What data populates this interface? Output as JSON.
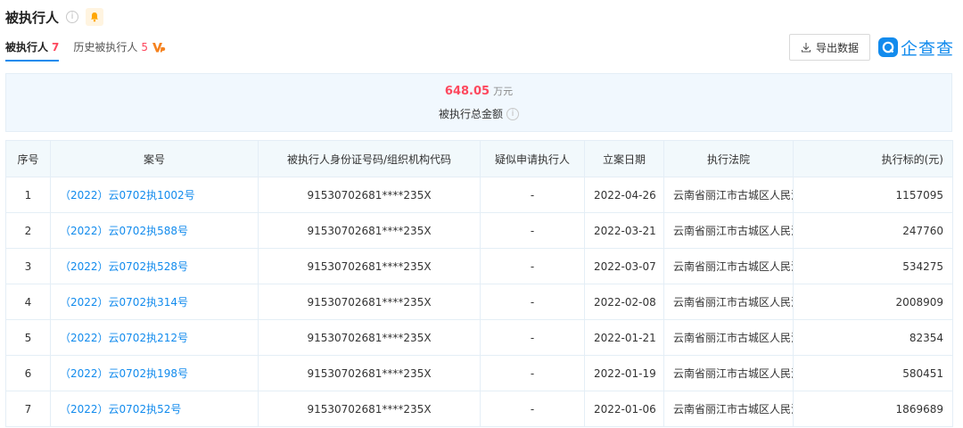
{
  "header": {
    "title": "被执行人",
    "info_glyph": "i"
  },
  "tabs": [
    {
      "label": "被执行人",
      "count": "7",
      "active": true
    },
    {
      "label": "历史被执行人",
      "count": "5",
      "active": false
    }
  ],
  "toolbar": {
    "export_label": "导出数据",
    "brand": "企查查"
  },
  "summary": {
    "amount": "648.05",
    "unit": "万元",
    "label": "被执行总金额"
  },
  "table": {
    "columns": [
      "序号",
      "案号",
      "被执行人身份证号码/组织机构代码",
      "疑似申请执行人",
      "立案日期",
      "执行法院",
      "执行标的(元)"
    ],
    "rows": [
      {
        "no": "1",
        "case": "（2022）云0702执1002号",
        "id": "91530702681****235X",
        "applicant": "-",
        "date": "2022-04-26",
        "court": "云南省丽江市古城区人民法院",
        "amount": "1157095"
      },
      {
        "no": "2",
        "case": "（2022）云0702执588号",
        "id": "91530702681****235X",
        "applicant": "-",
        "date": "2022-03-21",
        "court": "云南省丽江市古城区人民法院",
        "amount": "247760"
      },
      {
        "no": "3",
        "case": "（2022）云0702执528号",
        "id": "91530702681****235X",
        "applicant": "-",
        "date": "2022-03-07",
        "court": "云南省丽江市古城区人民法院",
        "amount": "534275"
      },
      {
        "no": "4",
        "case": "（2022）云0702执314号",
        "id": "91530702681****235X",
        "applicant": "-",
        "date": "2022-02-08",
        "court": "云南省丽江市古城区人民法院",
        "amount": "2008909"
      },
      {
        "no": "5",
        "case": "（2022）云0702执212号",
        "id": "91530702681****235X",
        "applicant": "-",
        "date": "2022-01-21",
        "court": "云南省丽江市古城区人民法院",
        "amount": "82354"
      },
      {
        "no": "6",
        "case": "（2022）云0702执198号",
        "id": "91530702681****235X",
        "applicant": "-",
        "date": "2022-01-19",
        "court": "云南省丽江市古城区人民法院",
        "amount": "580451"
      },
      {
        "no": "7",
        "case": "（2022）云0702执52号",
        "id": "91530702681****235X",
        "applicant": "-",
        "date": "2022-01-06",
        "court": "云南省丽江市古城区人民法院",
        "amount": "1869689"
      }
    ]
  },
  "colors": {
    "accent": "#128bed",
    "amount_red": "#fd485e",
    "summary_bg": "#f1f8fe",
    "header_bg": "#f2f9fc"
  },
  "icons": {
    "info": "info-icon",
    "bell": "bell-icon",
    "vip": "vip-icon",
    "download": "download-icon",
    "brand": "qichacha-logo-icon"
  }
}
